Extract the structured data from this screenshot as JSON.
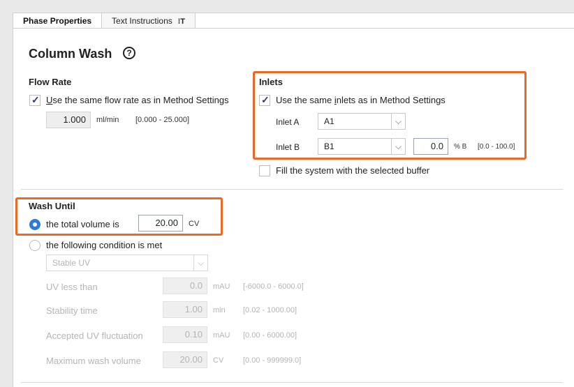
{
  "tabs": [
    {
      "label": "Phase Properties",
      "active": true
    },
    {
      "label": "Text Instructions",
      "icon_text": "⁝T",
      "active": false
    }
  ],
  "page_title": "Column Wash",
  "help_icon": "?",
  "flow_rate": {
    "heading": "Flow Rate",
    "same_label_prefix": "U",
    "same_label_rest": "se the same flow rate as in Method Settings",
    "checked": true,
    "value": "1.000",
    "unit": "ml/min",
    "range": "[0.000 - 25.000]"
  },
  "inlets": {
    "heading": "Inlets",
    "same_label_a": "Use the same ",
    "same_label_u": "i",
    "same_label_b": "nlets as in Method Settings",
    "checked": true,
    "inlet_a_label": "Inlet A",
    "inlet_a_value": "A1",
    "inlet_b_label": "Inlet B",
    "inlet_b_value": "B1",
    "percent_b_value": "0.0",
    "percent_b_unit": "% B",
    "percent_b_range": "[0.0 - 100.0]",
    "fill_label": "Fill the system with the selected buffer",
    "fill_checked": false
  },
  "wash_until": {
    "heading": "Wash Until",
    "option_volume_label": "the total volume is",
    "volume_value": "20.00",
    "volume_unit": "CV",
    "volume_selected": true,
    "option_condition_label": "the following condition is met",
    "condition_selected": false,
    "condition_select": "Stable UV",
    "params": [
      {
        "label": "UV less than",
        "value": "0.0",
        "unit": "mAU",
        "range": "[-6000.0 - 6000.0]"
      },
      {
        "label": "Stability time",
        "value": "1.00",
        "unit": "min",
        "range": "[0.02 - 1000.00]"
      },
      {
        "label": "Accepted UV fluctuation",
        "value": "0.10",
        "unit": "mAU",
        "range": "[0.00 - 6000.00]"
      },
      {
        "label": "Maximum wash volume",
        "value": "20.00",
        "unit": "CV",
        "range": "[0.00 - 999999.0]"
      }
    ]
  },
  "colors": {
    "highlight": "#e86a2a",
    "radio_selected": "#2f7bd8",
    "checkmark": "#2b3b60"
  }
}
